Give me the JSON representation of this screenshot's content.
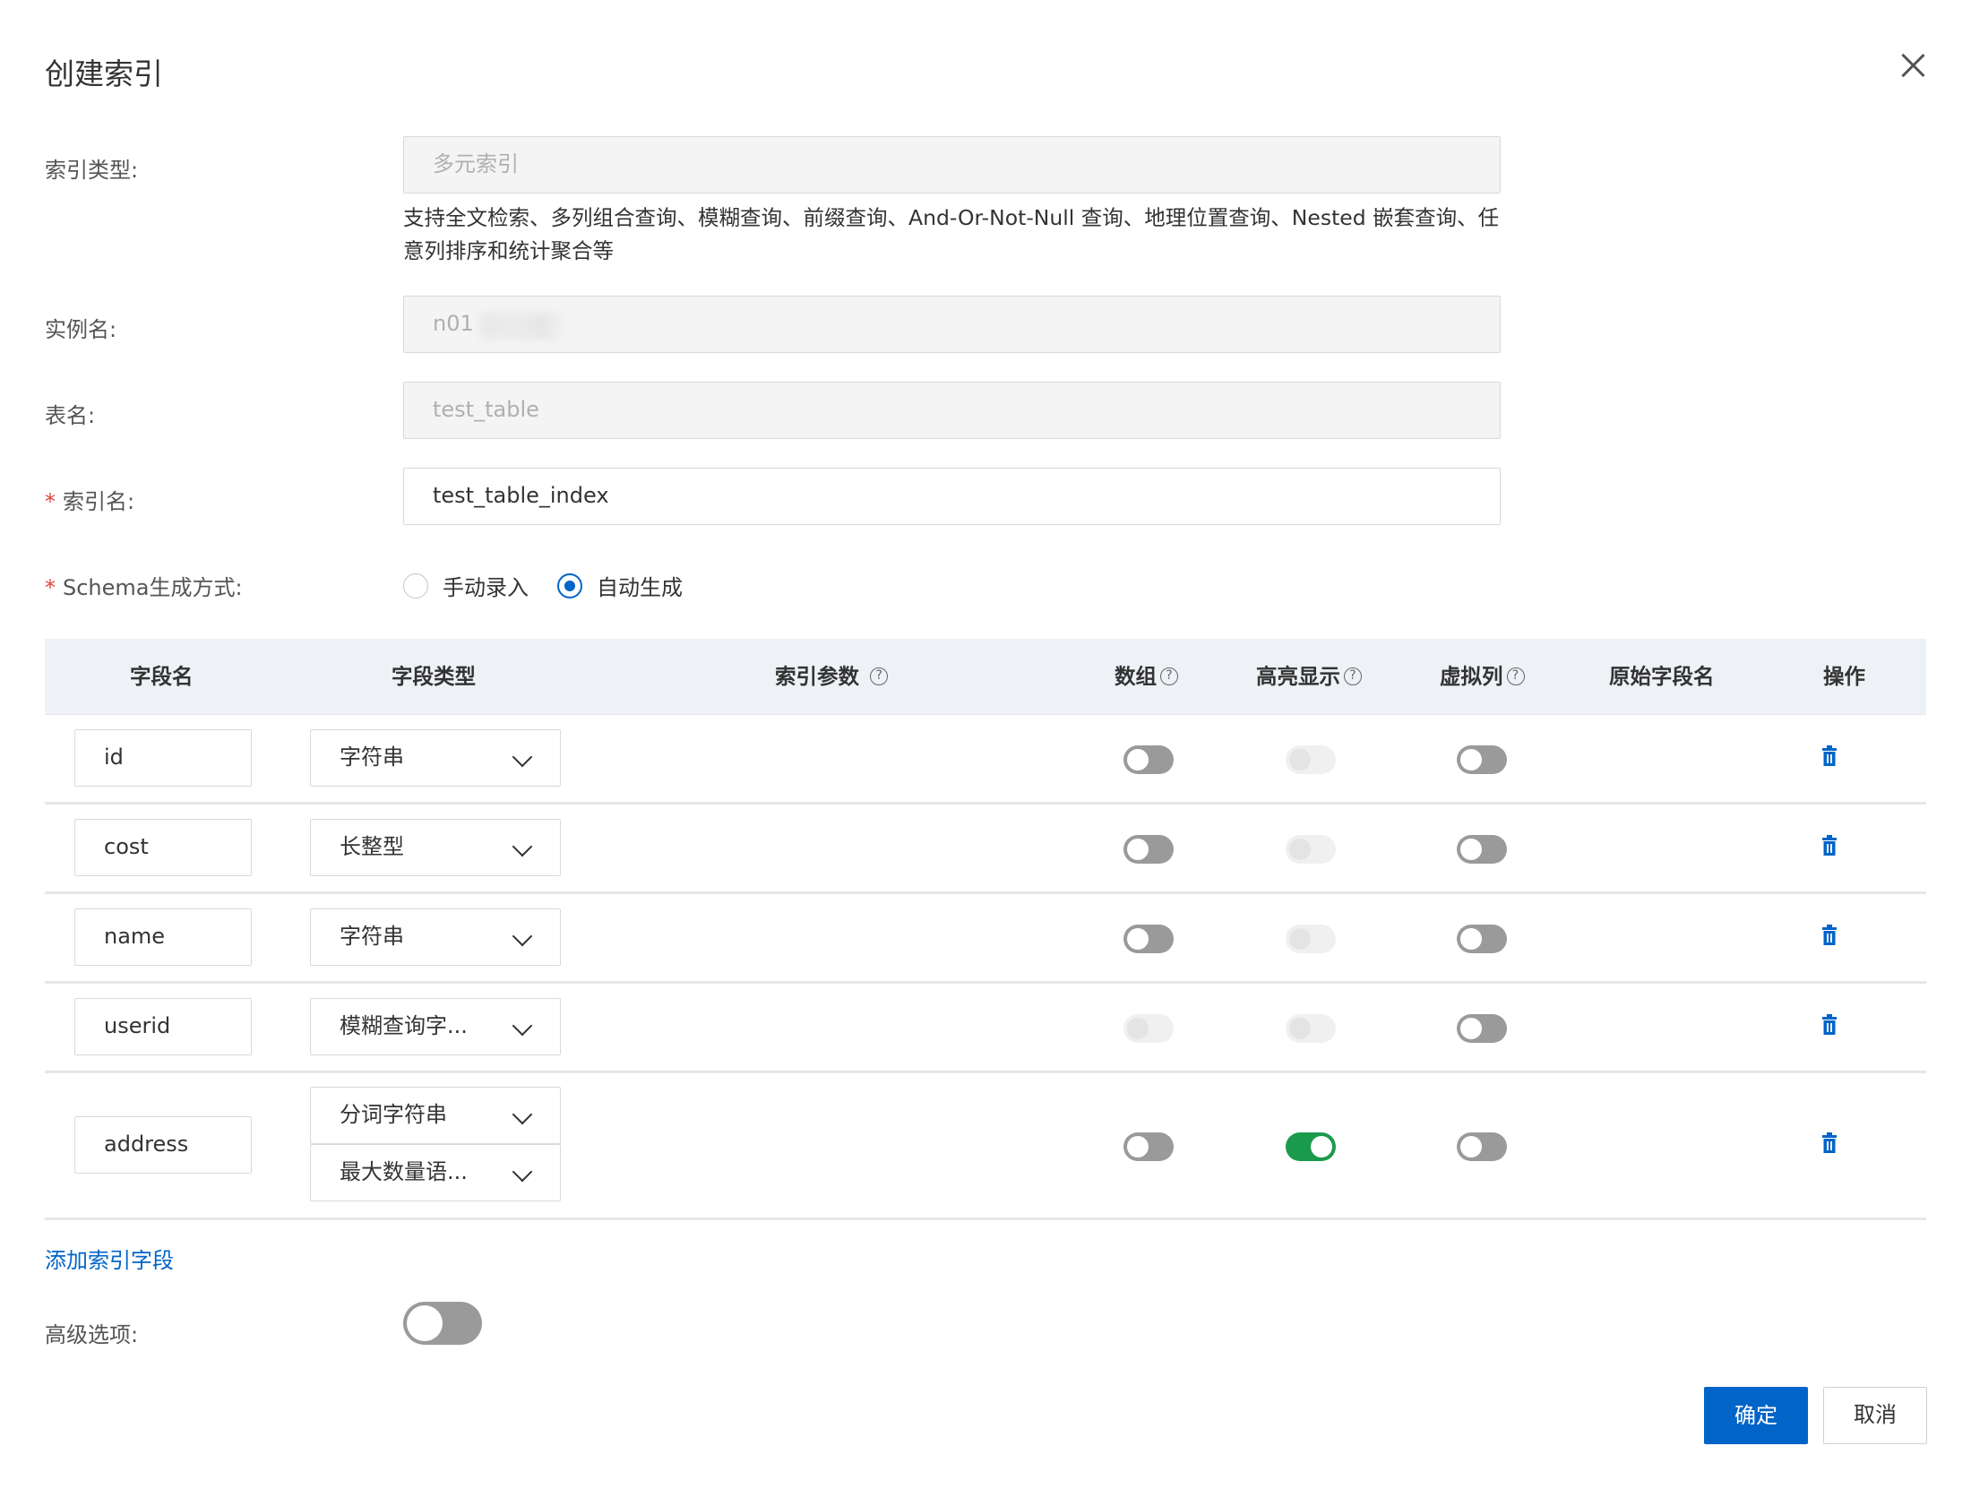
{
  "dialog": {
    "title": "创建索引"
  },
  "form": {
    "index_type": {
      "label": "索引类型:",
      "value": "多元索引"
    },
    "description": "支持全文检索、多列组合查询、模糊查询、前缀查询、And-Or-Not-Null 查询、地理位置查询、Nested 嵌套查询、任意列排序和统计聚合等",
    "instance": {
      "label": "实例名:",
      "value": "n01"
    },
    "table": {
      "label": "表名:",
      "value": "test_table"
    },
    "index_name": {
      "required": "*",
      "label": "索引名:",
      "value": "test_table_index"
    },
    "schema_mode": {
      "required": "*",
      "label": "Schema生成方式:",
      "options": [
        {
          "label": "手动录入",
          "selected": false
        },
        {
          "label": "自动生成",
          "selected": true
        }
      ]
    }
  },
  "table": {
    "headers": {
      "field_name": "字段名",
      "field_type": "字段类型",
      "index_params": "索引参数",
      "array": "数组",
      "highlight": "高亮显示",
      "virtual": "虚拟列",
      "source_field": "原始字段名",
      "actions": "操作"
    },
    "help_glyph": "?",
    "rows": [
      {
        "name": "id",
        "types": [
          "字符串"
        ],
        "array": "off",
        "highlight": "disabled",
        "virtual": "off"
      },
      {
        "name": "cost",
        "types": [
          "长整型"
        ],
        "array": "off",
        "highlight": "disabled",
        "virtual": "off"
      },
      {
        "name": "name",
        "types": [
          "字符串"
        ],
        "array": "off",
        "highlight": "disabled",
        "virtual": "off"
      },
      {
        "name": "userid",
        "types": [
          "模糊查询字..."
        ],
        "array": "disabled",
        "highlight": "disabled",
        "virtual": "off"
      },
      {
        "name": "address",
        "types": [
          "分词字符串",
          "最大数量语..."
        ],
        "array": "off",
        "highlight": "on",
        "virtual": "off"
      }
    ]
  },
  "add_field_link": "添加索引字段",
  "advanced": {
    "label": "高级选项:",
    "enabled": false
  },
  "buttons": {
    "confirm": "确定",
    "cancel": "取消"
  },
  "colors": {
    "primary": "#0064c8",
    "toggle_on": "#1a9a4b",
    "required": "#e2443b"
  },
  "icons": {
    "close": "close-icon",
    "delete": "trash-icon",
    "help": "help-icon",
    "dropdown": "chevron-down-icon"
  }
}
